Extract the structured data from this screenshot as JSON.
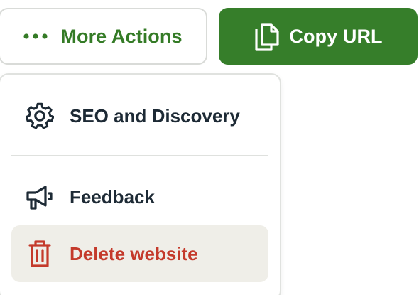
{
  "toolbar": {
    "more_actions": {
      "label": "More Actions",
      "icon": "more-dots-icon",
      "color": "#347b26"
    },
    "copy_url": {
      "label": "Copy URL",
      "icon": "copy-icon",
      "background": "#367e2a"
    }
  },
  "menu": {
    "items": [
      {
        "label": "SEO and Discovery",
        "icon": "gear-icon"
      },
      {
        "label": "Feedback",
        "icon": "megaphone-icon"
      },
      {
        "label": "Delete website",
        "icon": "trash-icon",
        "color": "#c43a2b",
        "highlighted": true
      }
    ]
  }
}
